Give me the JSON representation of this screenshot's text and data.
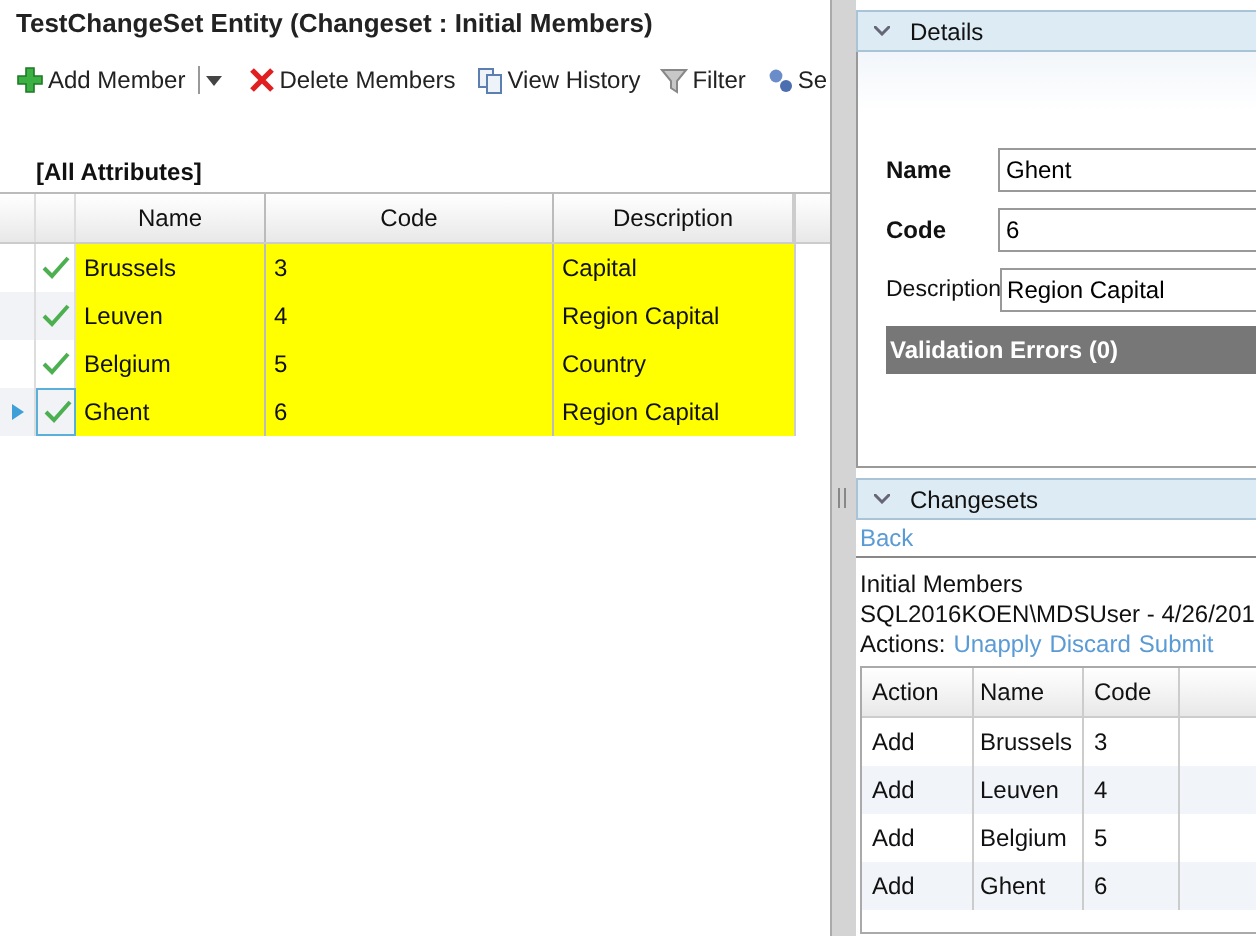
{
  "title": "TestChangeSet Entity (Changeset : Initial Members)",
  "toolbar": [
    {
      "kind": "add",
      "label": "Add Member",
      "dropdown": true
    },
    {
      "kind": "delete",
      "label": "Delete Members",
      "dropdown": false
    },
    {
      "kind": "history",
      "label": "View History",
      "dropdown": false
    },
    {
      "kind": "filter",
      "label": "Filter",
      "dropdown": false
    },
    {
      "kind": "settings",
      "label": "Se",
      "dropdown": false
    }
  ],
  "view_label": "[All Attributes]",
  "grid": {
    "columns": [
      "Name",
      "Code",
      "Description"
    ],
    "rows": [
      {
        "cells": [
          "Brussels",
          "3",
          "Capital"
        ],
        "valid": true,
        "selected": false
      },
      {
        "cells": [
          "Leuven",
          "4",
          "Region Capital"
        ],
        "valid": true,
        "selected": false
      },
      {
        "cells": [
          "Belgium",
          "5",
          "Country"
        ],
        "valid": true,
        "selected": false
      },
      {
        "cells": [
          "Ghent",
          "6",
          "Region Capital"
        ],
        "valid": true,
        "selected": true
      }
    ]
  },
  "details": {
    "header": "Details",
    "expanded": true,
    "fields": [
      {
        "label": "Name",
        "value": "Ghent",
        "required": true
      },
      {
        "label": "Code",
        "value": "6",
        "required": true
      },
      {
        "label": "Description",
        "value": "Region Capital",
        "required": false
      }
    ],
    "validation": "Validation Errors (0)"
  },
  "changesets": {
    "header": "Changesets",
    "expanded": true,
    "back": "Back",
    "name": "Initial Members",
    "owner": "SQL2016KOEN\\MDSUser - 4/26/201",
    "actions_label": "Actions:",
    "actions": [
      "Unapply",
      "Discard",
      "Submit"
    ],
    "columns": [
      "Action",
      "Name",
      "Code"
    ],
    "rows": [
      [
        "Add",
        "Brussels",
        "3"
      ],
      [
        "Add",
        "Leuven",
        "4"
      ],
      [
        "Add",
        "Belgium",
        "5"
      ],
      [
        "Add",
        "Ghent",
        "6"
      ]
    ]
  }
}
